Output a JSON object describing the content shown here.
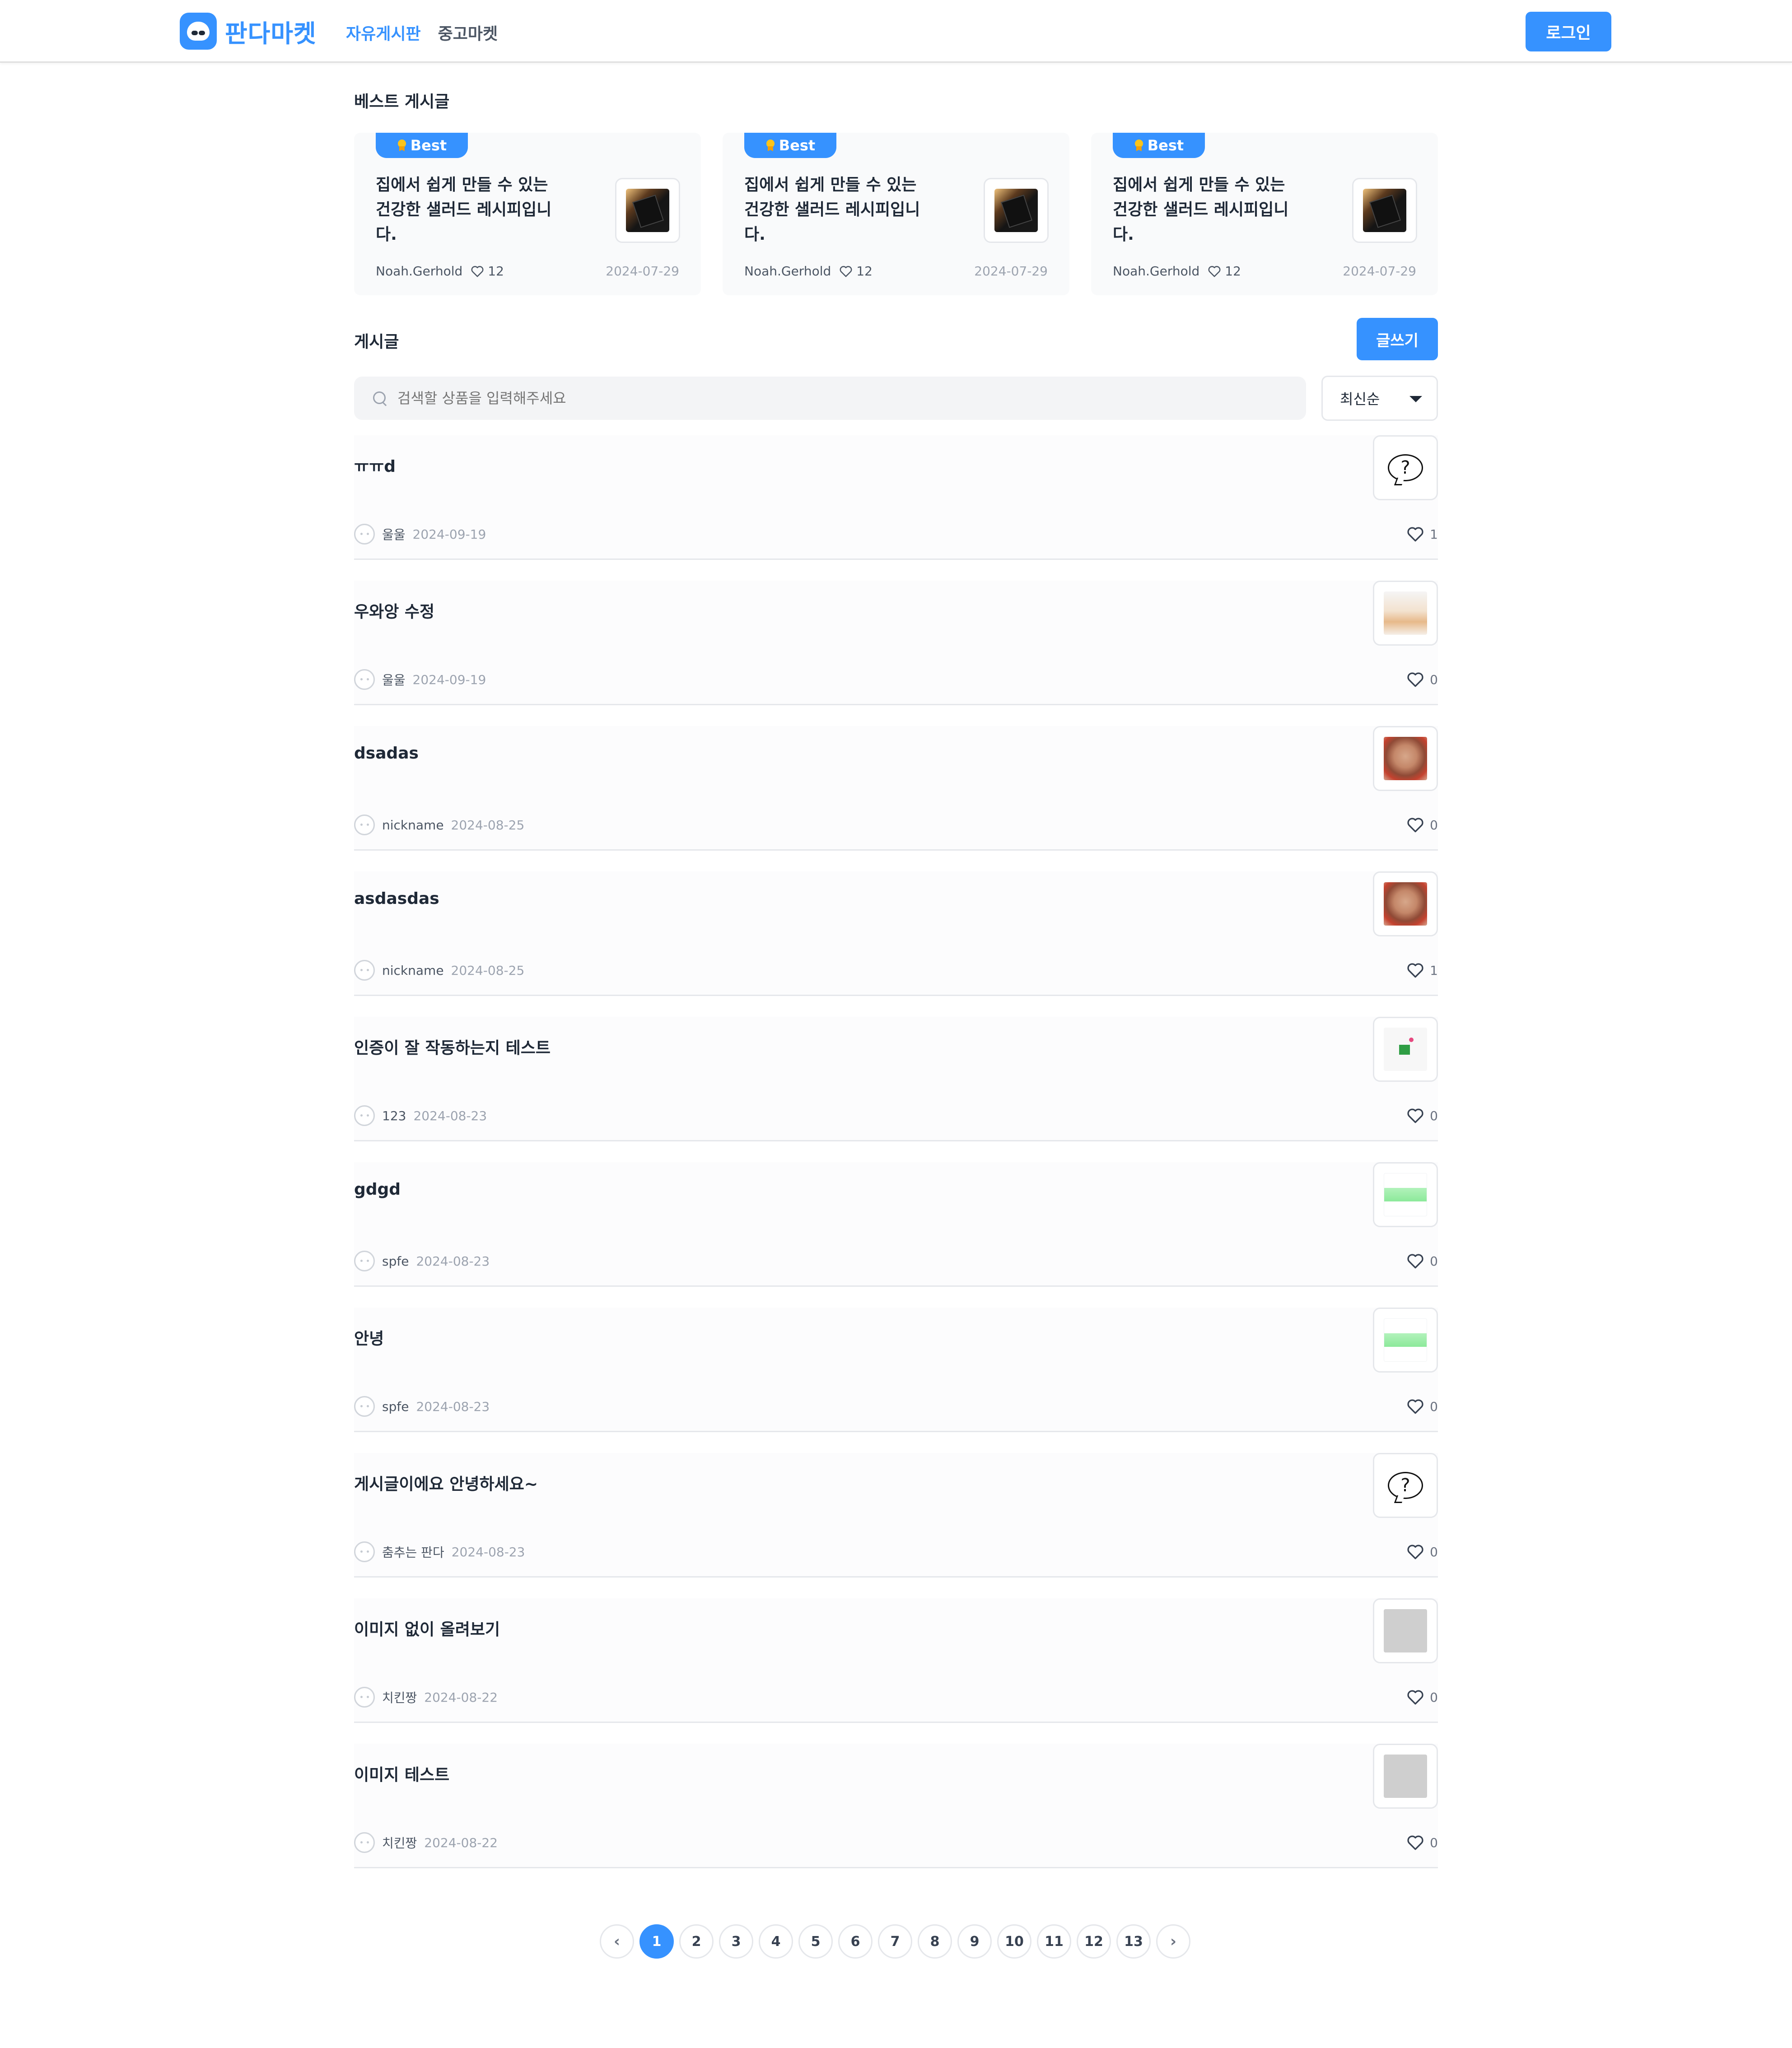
{
  "header": {
    "logo_text": "판다마켓",
    "nav": [
      "자유게시판",
      "중고마켓"
    ],
    "login_label": "로그인"
  },
  "best_section": {
    "title": "베스트 게시글",
    "badge": "Best",
    "cards": [
      {
        "title": "집에서 쉽게 만들 수 있는 건강한 샐러드 레시피입니다.",
        "author": "Noah.Gerhold",
        "likes": "12",
        "date": "2024-07-29"
      },
      {
        "title": "집에서 쉽게 만들 수 있는 건강한 샐러드 레시피입니다.",
        "author": "Noah.Gerhold",
        "likes": "12",
        "date": "2024-07-29"
      },
      {
        "title": "집에서 쉽게 만들 수 있는 건강한 샐러드 레시피입니다.",
        "author": "Noah.Gerhold",
        "likes": "12",
        "date": "2024-07-29"
      }
    ]
  },
  "posts_section": {
    "title": "게시글",
    "write_label": "글쓰기",
    "search_placeholder": "검색할 상품을 입력해주세요",
    "sort_selected": "최신순",
    "posts": [
      {
        "title": "ㅠㅠd",
        "author": "울울",
        "date": "2024-09-19",
        "likes": "1",
        "thumb": "speech-bubble"
      },
      {
        "title": "우와앙 수정",
        "author": "울울",
        "date": "2024-09-19",
        "likes": "0",
        "thumb": "cat-photo"
      },
      {
        "title": "dsadas",
        "author": "nickname",
        "date": "2024-08-25",
        "likes": "0",
        "thumb": "teddy-bear-photo"
      },
      {
        "title": "asdasdas",
        "author": "nickname",
        "date": "2024-08-25",
        "likes": "1",
        "thumb": "teddy-bear-photo"
      },
      {
        "title": "인증이 잘 작동하는지 테스트",
        "author": "123",
        "date": "2024-08-23",
        "likes": "0",
        "thumb": "gift-illustration"
      },
      {
        "title": "gdgd",
        "author": "spfe",
        "date": "2024-08-23",
        "likes": "0",
        "thumb": "green-banner"
      },
      {
        "title": "안녕",
        "author": "spfe",
        "date": "2024-08-23",
        "likes": "0",
        "thumb": "green-banner"
      },
      {
        "title": "게시글이에요 안녕하세요~",
        "author": "춤추는 판다",
        "date": "2024-08-23",
        "likes": "0",
        "thumb": "speech-bubble"
      },
      {
        "title": "이미지 없이 올려보기",
        "author": "치킨짱",
        "date": "2024-08-22",
        "likes": "0",
        "thumb": "gray-placeholder"
      },
      {
        "title": "이미지 테스트",
        "author": "치킨짱",
        "date": "2024-08-22",
        "likes": "0",
        "thumb": "gray-placeholder"
      }
    ]
  },
  "pagination": {
    "prev": "‹",
    "next": "›",
    "pages": [
      "1",
      "2",
      "3",
      "4",
      "5",
      "6",
      "7",
      "8",
      "9",
      "10",
      "11",
      "12",
      "13"
    ],
    "current": "1"
  },
  "colors": {
    "accent": "#3692ff",
    "text": "#1f2937",
    "muted": "#9ca3af"
  },
  "icons": [
    "panda-logo-icon",
    "medal-icon",
    "heart-icon",
    "search-icon",
    "caret-down-icon",
    "avatar-icon",
    "chevron-left-icon",
    "chevron-right-icon"
  ]
}
